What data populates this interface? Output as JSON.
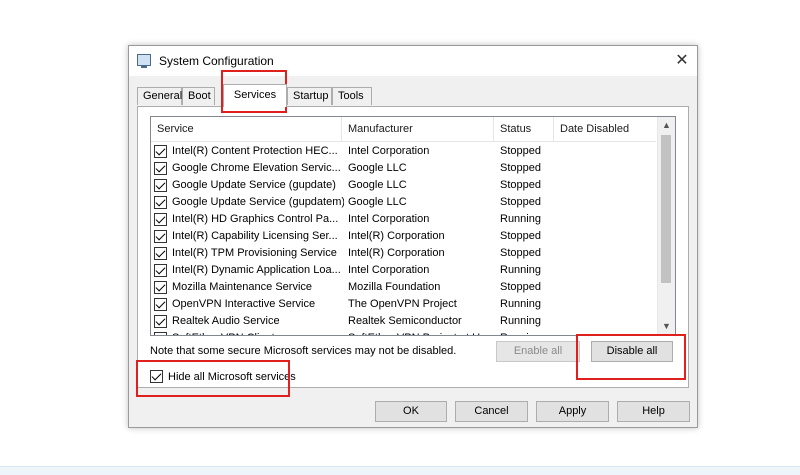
{
  "window": {
    "title": "System Configuration"
  },
  "tabs": [
    {
      "label": "General"
    },
    {
      "label": "Boot"
    },
    {
      "label": "Services"
    },
    {
      "label": "Startup"
    },
    {
      "label": "Tools"
    }
  ],
  "columns": [
    "Service",
    "Manufacturer",
    "Status",
    "Date Disabled"
  ],
  "services": [
    {
      "name": "Intel(R) Content Protection HEC...",
      "manufacturer": "Intel Corporation",
      "status": "Stopped",
      "date_disabled": ""
    },
    {
      "name": "Google Chrome Elevation Servic...",
      "manufacturer": "Google LLC",
      "status": "Stopped",
      "date_disabled": ""
    },
    {
      "name": "Google Update Service (gupdate)",
      "manufacturer": "Google LLC",
      "status": "Stopped",
      "date_disabled": ""
    },
    {
      "name": "Google Update Service (gupdatem)",
      "manufacturer": "Google LLC",
      "status": "Stopped",
      "date_disabled": ""
    },
    {
      "name": "Intel(R) HD Graphics Control Pa...",
      "manufacturer": "Intel Corporation",
      "status": "Running",
      "date_disabled": ""
    },
    {
      "name": "Intel(R) Capability Licensing Ser...",
      "manufacturer": "Intel(R) Corporation",
      "status": "Stopped",
      "date_disabled": ""
    },
    {
      "name": "Intel(R) TPM Provisioning Service",
      "manufacturer": "Intel(R) Corporation",
      "status": "Stopped",
      "date_disabled": ""
    },
    {
      "name": "Intel(R) Dynamic Application Loa...",
      "manufacturer": "Intel Corporation",
      "status": "Running",
      "date_disabled": ""
    },
    {
      "name": "Mozilla Maintenance Service",
      "manufacturer": "Mozilla Foundation",
      "status": "Stopped",
      "date_disabled": ""
    },
    {
      "name": "OpenVPN Interactive Service",
      "manufacturer": "The OpenVPN Project",
      "status": "Running",
      "date_disabled": ""
    },
    {
      "name": "Realtek Audio Service",
      "manufacturer": "Realtek Semiconductor",
      "status": "Running",
      "date_disabled": ""
    },
    {
      "name": "SoftEther VPN Client",
      "manufacturer": "SoftEther VPN Project at U...",
      "status": "Running",
      "date_disabled": ""
    }
  ],
  "note": "Note that some secure Microsoft services may not be disabled.",
  "buttons": {
    "enable_all": "Enable all",
    "disable_all": "Disable all",
    "ok": "OK",
    "cancel": "Cancel",
    "apply": "Apply",
    "help": "Help"
  },
  "hide_ms": {
    "label": "Hide all Microsoft services",
    "checked": true
  },
  "icons": {
    "close": "close-icon",
    "scroll_up": "chevron-up-icon",
    "scroll_down": "chevron-down-icon"
  },
  "colors": {
    "highlight": "#e0201f"
  }
}
